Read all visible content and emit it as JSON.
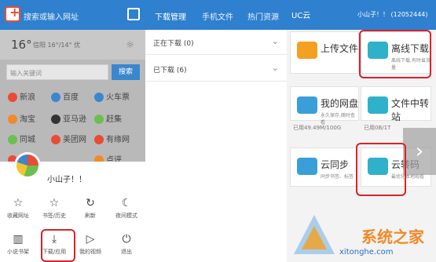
{
  "left": {
    "url_placeholder": "搜索或输入网址",
    "weather": {
      "temp": "16°",
      "info": "信阳  16°/14°  优",
      "sun": "☼"
    },
    "search": {
      "placeholder": "输入关键词",
      "button": "搜索"
    },
    "sites": [
      {
        "label": "新浪",
        "color": "#e94b35"
      },
      {
        "label": "百度",
        "color": "#3a86cf"
      },
      {
        "label": "火车票",
        "color": "#3a86cf"
      },
      {
        "label": "淘宝",
        "color": "#f08a2a"
      },
      {
        "label": "亚马逊",
        "color": "#333333"
      },
      {
        "label": "赶集",
        "color": "#6bbf4e"
      },
      {
        "label": "同城",
        "color": "#6bbf4e"
      },
      {
        "label": "美团网",
        "color": "#e94b35"
      },
      {
        "label": "有缘网",
        "color": "#e94b35"
      },
      {
        "label": "凤凰",
        "color": "#e94b35"
      },
      {
        "label": "",
        "color": "#3a86cf"
      },
      {
        "label": "点评",
        "color": "#f08a2a"
      }
    ],
    "user": {
      "name": "小山子！！"
    },
    "menu": [
      {
        "label": "收藏网址",
        "icon": "star-add-icon",
        "glyph": "☆"
      },
      {
        "label": "书签/历史",
        "icon": "bookmark-star-icon",
        "glyph": "☆"
      },
      {
        "label": "刷新",
        "icon": "refresh-icon",
        "glyph": "↻"
      },
      {
        "label": "夜间模式",
        "icon": "moon-icon",
        "glyph": "☾"
      },
      {
        "label": "小说书架",
        "icon": "book-icon",
        "glyph": "▥"
      },
      {
        "label": "下载/应用",
        "icon": "download-icon",
        "glyph": "⤓"
      },
      {
        "label": "我的视频",
        "icon": "video-icon",
        "glyph": "▷"
      },
      {
        "label": "退出",
        "icon": "power-icon",
        "glyph": "⏻"
      }
    ]
  },
  "mid": {
    "tabs": [
      "下载管理",
      "手机文件",
      "热门资源"
    ],
    "rows": [
      "正在下载 (0)",
      "已下载 (6)"
    ]
  },
  "right": {
    "title": "UC云",
    "account": "小山子！！ (12052444)",
    "cards": [
      {
        "title": "上传文件",
        "sub": "",
        "color": "#f4a020"
      },
      {
        "title": "离线下载",
        "sub": "离线下载,有时省流量",
        "color": "#2fb1c9"
      },
      {
        "title": "我的网盘",
        "sub": "永久保存,随时查看",
        "color": "#3a9fd8"
      },
      {
        "title": "文件中转站",
        "sub": "",
        "color": "#2fb1c9"
      },
      {
        "title": "云同步",
        "sub": "同步书签、标签",
        "color": "#3a9fd8"
      },
      {
        "title": "云转码",
        "sub": "最优化本地观看",
        "color": "#2fb1c9"
      }
    ],
    "quota_left": "已用49.49M/100G",
    "quota_right": "已用0B/1T",
    "next": "›"
  },
  "watermark": {
    "text": "系统之家",
    "url": "xitonghe.com"
  },
  "colors": {
    "brand_blue": "#2f80cf",
    "highlight_red": "#d8232a"
  }
}
